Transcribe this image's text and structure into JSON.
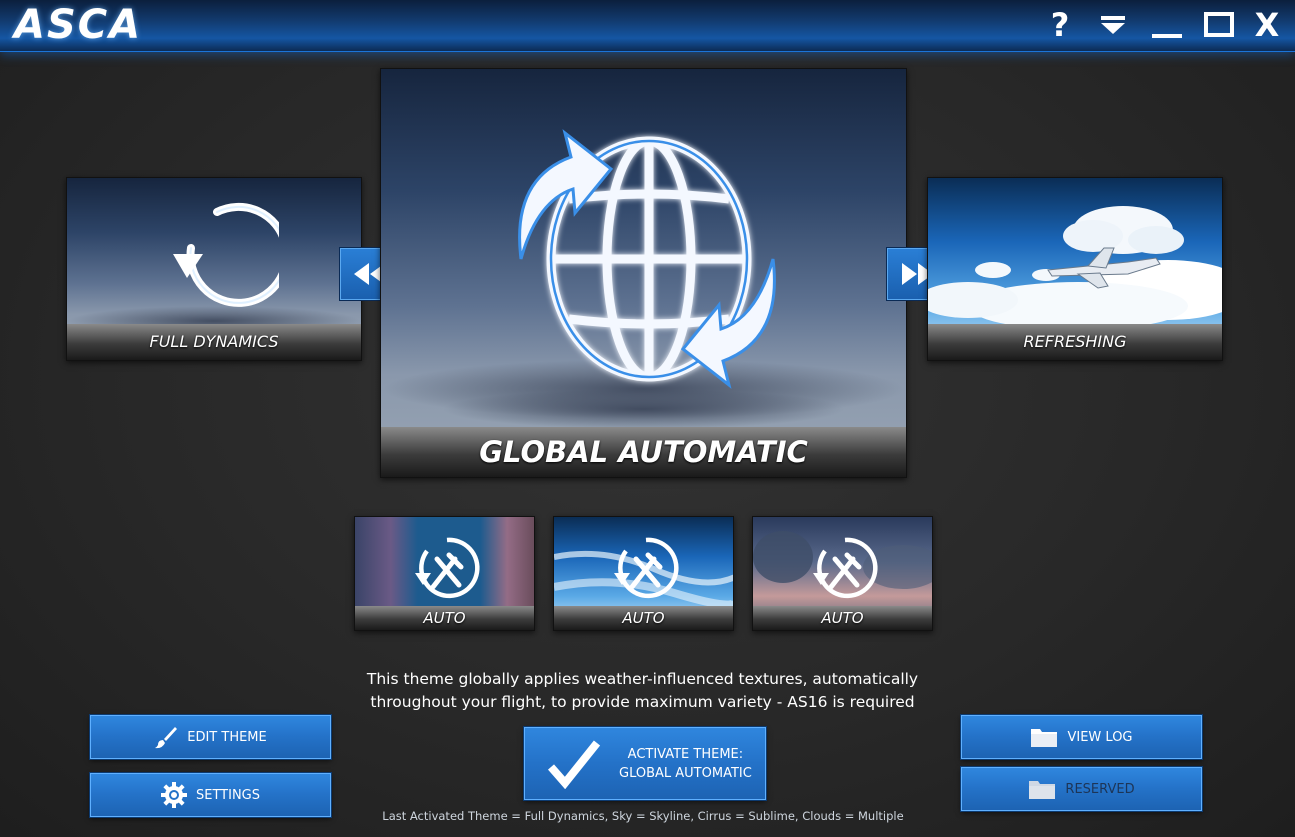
{
  "app": {
    "title": "ASCA"
  },
  "window_controls": {
    "help": "?",
    "close": "X"
  },
  "carousel": {
    "previous_theme": "FULL DYNAMICS",
    "current_theme": "GLOBAL AUTOMATIC",
    "next_theme": "REFRESHING"
  },
  "sub_themes": [
    {
      "label": "AUTO"
    },
    {
      "label": "AUTO"
    },
    {
      "label": "AUTO"
    }
  ],
  "description": {
    "line1": "This theme globally applies weather-influenced textures, automatically",
    "line2": "throughout your flight, to provide maximum variety - AS16 is required"
  },
  "buttons": {
    "edit_theme": "EDIT THEME",
    "settings": "SETTINGS",
    "activate_line1": "ACTIVATE THEME:",
    "activate_line2": "GLOBAL AUTOMATIC",
    "view_log": "VIEW LOG",
    "reserved": "RESERVED"
  },
  "footer": {
    "status": "Last Activated Theme = Full Dynamics, Sky = Skyline, Cirrus = Sublime, Clouds = Multiple"
  },
  "colors": {
    "accent": "#2472c8",
    "accent_border": "#5fb0ff",
    "background": "#2a2a2a"
  }
}
